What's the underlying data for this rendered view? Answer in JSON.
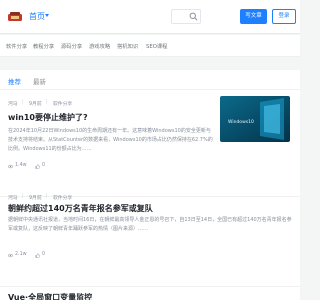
{
  "header": {
    "home_label": "首页",
    "write_label": "写文章",
    "login_label": "登录",
    "brand_color": "#1e80ff"
  },
  "categories": [
    "软件分享",
    "教程分享",
    "源码分享",
    "游戏攻略",
    "搭机知识",
    "SEO课程"
  ],
  "tabs": [
    "推荐",
    "最新"
  ],
  "articles": [
    {
      "author": "河马",
      "time": "9月前",
      "category": "软件分享",
      "title": "win10要停止维护了?",
      "excerpt": "在2024年10月22日Windows10的生命周期还有一年。这意味着Windows10的安全更新与技术支持将结束。从StatCounter的数据来看，Windows10的市场占比仍然保持在62.7%的比例。Windows11的份额占比为……",
      "views": "1.4w",
      "likes": "0",
      "thumb_text": "Windows 10",
      "thumb_label": "Windows10"
    },
    {
      "author": "河马",
      "time": "9月前",
      "category": "软件分享",
      "title": "朝鲜约超过140万名青年报名参军或复队",
      "excerpt": "据朝鲜中央通讯社报道，当地时间16日，在朝鲜最高领导人金正恩的号召下，自13日至14日，全国已有超过140万名青年报名参军或复队，这反映了朝鲜青年踊跃参军的热情（图片来源）……",
      "views": "2.1w",
      "likes": "0"
    },
    {
      "title": "Vue·全局窗口变量监控"
    }
  ],
  "thumb_color": "#0a5a7a"
}
